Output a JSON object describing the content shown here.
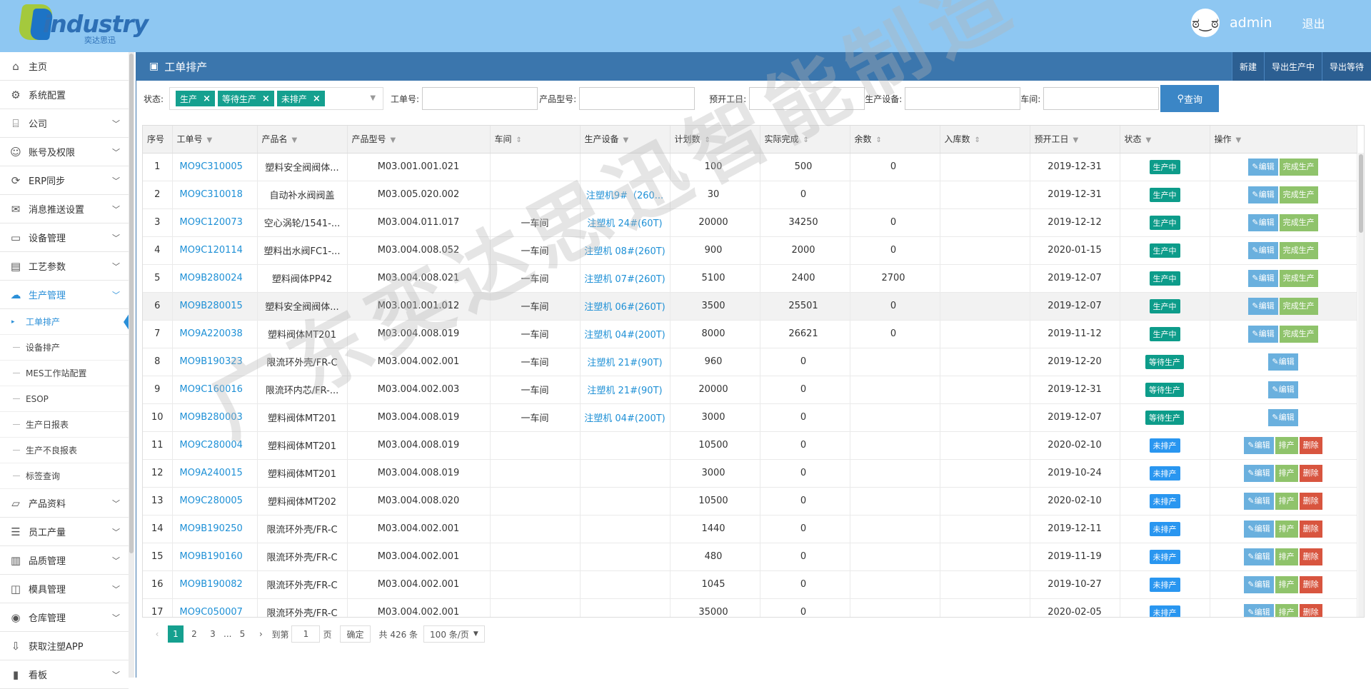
{
  "header": {
    "logo_text": "industry",
    "logo_sub": "奕达思迅",
    "avatar_glyph": "ಠ‿ಠ",
    "username": "admin",
    "logout": "退出"
  },
  "sidebar": {
    "items": [
      {
        "label": "主页",
        "icon": "home-icon",
        "glyph": "⌂",
        "chev": false
      },
      {
        "label": "系统配置",
        "icon": "gear-icon",
        "glyph": "⚙",
        "chev": false
      },
      {
        "label": "公司",
        "icon": "bank-icon",
        "glyph": "⌸",
        "chev": true
      },
      {
        "label": "账号及权限",
        "icon": "user-icon",
        "glyph": "☺",
        "chev": true
      },
      {
        "label": "ERP同步",
        "icon": "sync-icon",
        "glyph": "⟳",
        "chev": true
      },
      {
        "label": "消息推送设置",
        "icon": "chat-icon",
        "glyph": "✉",
        "chev": true
      },
      {
        "label": "设备管理",
        "icon": "monitor-icon",
        "glyph": "▭",
        "chev": true
      },
      {
        "label": "工艺参数",
        "icon": "inbox-icon",
        "glyph": "▤",
        "chev": true
      },
      {
        "label": "生产管理",
        "icon": "cloud-icon",
        "glyph": "☁",
        "chev": true,
        "active": true
      }
    ],
    "subitems": [
      "工单排产",
      "设备排产",
      "MES工作站配置",
      "ESOP",
      "生产日报表",
      "生产不良报表",
      "标签查询"
    ],
    "items2": [
      {
        "label": "产品资料",
        "icon": "folder-icon",
        "glyph": "▱",
        "chev": true
      },
      {
        "label": "员工产量",
        "icon": "list-icon",
        "glyph": "☰",
        "chev": true
      },
      {
        "label": "品质管理",
        "icon": "book-icon",
        "glyph": "▥",
        "chev": true
      },
      {
        "label": "模具管理",
        "icon": "mold-icon",
        "glyph": "◫",
        "chev": true
      },
      {
        "label": "仓库管理",
        "icon": "warehouse-icon",
        "glyph": "◉",
        "chev": true
      },
      {
        "label": "获取注塑APP",
        "icon": "download-icon",
        "glyph": "⇩",
        "chev": false
      },
      {
        "label": "看板",
        "icon": "chart-icon",
        "glyph": "▮",
        "chev": true
      }
    ]
  },
  "panel": {
    "title": "工单排产",
    "buttons": [
      "新建",
      "导出生产中",
      "导出等待"
    ]
  },
  "filter": {
    "status_label": "状态:",
    "tags": [
      "生产",
      "等待生产",
      "未排产"
    ],
    "order_label": "工单号:",
    "product_label": "产品型号:",
    "date_label": "预开工日:",
    "device_label": "生产设备:",
    "workshop_label": "车间:",
    "query": "查询"
  },
  "table": {
    "columns": [
      "序号",
      "工单号",
      "产品名",
      "产品型号",
      "车间",
      "生产设备",
      "计划数",
      "实际完成",
      "余数",
      "入库数",
      "预开工日",
      "状态",
      "操作"
    ],
    "rows": [
      {
        "no": "1",
        "order": "MO9C310005",
        "name": "塑料安全阀阀体...",
        "model": "M03.001.001.021",
        "ws": "",
        "dev": "",
        "plan": "100",
        "done": "500",
        "rem": "0",
        "stock": "",
        "date": "2019-12-31",
        "status": "生产中",
        "kind": "prod"
      },
      {
        "no": "2",
        "order": "MO9C310018",
        "name": "自动补水阀阀盖",
        "model": "M03.005.020.002",
        "ws": "",
        "dev": "注塑机9#（260...",
        "plan": "30",
        "done": "0",
        "rem": "",
        "stock": "",
        "date": "2019-12-31",
        "status": "生产中",
        "kind": "prod"
      },
      {
        "no": "3",
        "order": "MO9C120073",
        "name": "空心涡轮/1541-...",
        "model": "M03.004.011.017",
        "ws": "一车间",
        "dev": "注塑机 24#(60T)",
        "plan": "20000",
        "done": "34250",
        "rem": "0",
        "stock": "",
        "date": "2019-12-12",
        "status": "生产中",
        "kind": "prod"
      },
      {
        "no": "4",
        "order": "MO9C120114",
        "name": "塑料出水阀FC1-...",
        "model": "M03.004.008.052",
        "ws": "一车间",
        "dev": "注塑机 08#(260T)",
        "plan": "900",
        "done": "2000",
        "rem": "0",
        "stock": "",
        "date": "2020-01-15",
        "status": "生产中",
        "kind": "prod"
      },
      {
        "no": "5",
        "order": "MO9B280024",
        "name": "塑料阀体PP42",
        "model": "M03.004.008.021",
        "ws": "一车间",
        "dev": "注塑机 07#(260T)",
        "plan": "5100",
        "done": "2400",
        "rem": "2700",
        "stock": "",
        "date": "2019-12-07",
        "status": "生产中",
        "kind": "prod"
      },
      {
        "no": "6",
        "order": "MO9B280015",
        "name": "塑料安全阀阀体...",
        "model": "M03.001.001.012",
        "ws": "一车间",
        "dev": "注塑机 06#(260T)",
        "plan": "3500",
        "done": "25501",
        "rem": "0",
        "stock": "",
        "date": "2019-12-07",
        "status": "生产中",
        "kind": "prod"
      },
      {
        "no": "7",
        "order": "MO9A220038",
        "name": "塑料阀体MT201",
        "model": "M03.004.008.019",
        "ws": "一车间",
        "dev": "注塑机 04#(200T)",
        "plan": "8000",
        "done": "26621",
        "rem": "0",
        "stock": "",
        "date": "2019-11-12",
        "status": "生产中",
        "kind": "prod"
      },
      {
        "no": "8",
        "order": "MO9B190323",
        "name": "限流环外壳/FR-C",
        "model": "M03.004.002.001",
        "ws": "一车间",
        "dev": "注塑机 21#(90T)",
        "plan": "960",
        "done": "0",
        "rem": "",
        "stock": "",
        "date": "2019-12-20",
        "status": "等待生产",
        "kind": "wait"
      },
      {
        "no": "9",
        "order": "MO9C160016",
        "name": "限流环内芯/FR-...",
        "model": "M03.004.002.003",
        "ws": "一车间",
        "dev": "注塑机 21#(90T)",
        "plan": "20000",
        "done": "0",
        "rem": "",
        "stock": "",
        "date": "2019-12-31",
        "status": "等待生产",
        "kind": "wait"
      },
      {
        "no": "10",
        "order": "MO9B280003",
        "name": "塑料阀体MT201",
        "model": "M03.004.008.019",
        "ws": "一车间",
        "dev": "注塑机 04#(200T)",
        "plan": "3000",
        "done": "0",
        "rem": "",
        "stock": "",
        "date": "2019-12-07",
        "status": "等待生产",
        "kind": "wait"
      },
      {
        "no": "11",
        "order": "MO9C280004",
        "name": "塑料阀体MT201",
        "model": "M03.004.008.019",
        "ws": "",
        "dev": "",
        "plan": "10500",
        "done": "0",
        "rem": "",
        "stock": "",
        "date": "2020-02-10",
        "status": "未排产",
        "kind": "none"
      },
      {
        "no": "12",
        "order": "MO9A240015",
        "name": "塑料阀体MT201",
        "model": "M03.004.008.019",
        "ws": "",
        "dev": "",
        "plan": "3000",
        "done": "0",
        "rem": "",
        "stock": "",
        "date": "2019-10-24",
        "status": "未排产",
        "kind": "none"
      },
      {
        "no": "13",
        "order": "MO9C280005",
        "name": "塑料阀体MT202",
        "model": "M03.004.008.020",
        "ws": "",
        "dev": "",
        "plan": "10500",
        "done": "0",
        "rem": "",
        "stock": "",
        "date": "2020-02-10",
        "status": "未排产",
        "kind": "none"
      },
      {
        "no": "14",
        "order": "MO9B190250",
        "name": "限流环外壳/FR-C",
        "model": "M03.004.002.001",
        "ws": "",
        "dev": "",
        "plan": "1440",
        "done": "0",
        "rem": "",
        "stock": "",
        "date": "2019-12-11",
        "status": "未排产",
        "kind": "none"
      },
      {
        "no": "15",
        "order": "MO9B190160",
        "name": "限流环外壳/FR-C",
        "model": "M03.004.002.001",
        "ws": "",
        "dev": "",
        "plan": "480",
        "done": "0",
        "rem": "",
        "stock": "",
        "date": "2019-11-19",
        "status": "未排产",
        "kind": "none"
      },
      {
        "no": "16",
        "order": "MO9B190082",
        "name": "限流环外壳/FR-C",
        "model": "M03.004.002.001",
        "ws": "",
        "dev": "",
        "plan": "1045",
        "done": "0",
        "rem": "",
        "stock": "",
        "date": "2019-10-27",
        "status": "未排产",
        "kind": "none"
      },
      {
        "no": "17",
        "order": "MO9C050007",
        "name": "限流环外壳/FR-C",
        "model": "M03.004.002.001",
        "ws": "",
        "dev": "",
        "plan": "35000",
        "done": "0",
        "rem": "",
        "stock": "",
        "date": "2020-02-05",
        "status": "未排产",
        "kind": "none"
      }
    ],
    "actions": {
      "edit": "编辑",
      "done": "完成生产",
      "sched": "排产",
      "del": "删除"
    }
  },
  "pager": {
    "pages": [
      "1",
      "2",
      "3",
      "...",
      "5"
    ],
    "goto": "到第",
    "page_input": "1",
    "page_unit": "页",
    "confirm": "确定",
    "total": "共 426 条",
    "size": "100 条/页"
  },
  "watermark": "广东奕达思迅智能制造",
  "colors": {
    "topbar": "#8ec7f2",
    "panel": "#3b76ad",
    "tag": "#15a08f",
    "link": "#1e90d6"
  }
}
